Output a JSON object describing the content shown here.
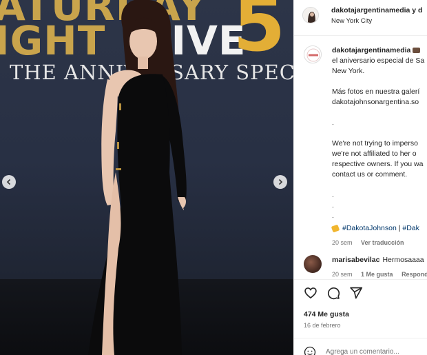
{
  "photo": {
    "backdrop_line1_gold": "ATURDAY",
    "backdrop_line1_line2_gold": "IGHT",
    "backdrop_line1_white": "LIVE",
    "backdrop_big_number": "5",
    "backdrop_line2": "THE ANNIVERSARY SPECIAL",
    "prev_icon": "chevron-left-icon",
    "next_icon": "chevron-right-icon"
  },
  "header": {
    "username": "dakotajargentinamedia y d",
    "location": "New York City"
  },
  "caption": {
    "username": "dakotajargentinamedia",
    "lines": [
      "el aniversario especial de Sa",
      "New York.",
      "",
      "Más fotos en nuestra galerí",
      "dakotajohnsonargentina.so",
      "",
      ".",
      "",
      "We're not trying to imperso",
      "we're not affiliated to her o",
      "respective owners. If you wa",
      "contact us or comment.",
      "",
      ".",
      ".",
      "."
    ],
    "hashtag_1": "#DakotaJohnson",
    "hashtag_sep": " | ",
    "hashtag_2": "#Dak",
    "time": "20 sem",
    "see_translation": "Ver traducción"
  },
  "comment": {
    "username": "marisabevilac",
    "text": "Hermosaaaa",
    "time": "20 sem",
    "likes": "1 Me gusta",
    "reply": "Respond"
  },
  "actions": {
    "like_icon": "heart-icon",
    "comment_icon": "comment-icon",
    "share_icon": "share-icon"
  },
  "likes_text": "474 Me gusta",
  "date_text": "16 de febrero",
  "comment_input": {
    "placeholder": "Agrega un comentario..."
  },
  "colors": {
    "hashtag": "#00376b",
    "backdrop_gold": "#c9a44c",
    "backdrop_bg": "#283044"
  }
}
